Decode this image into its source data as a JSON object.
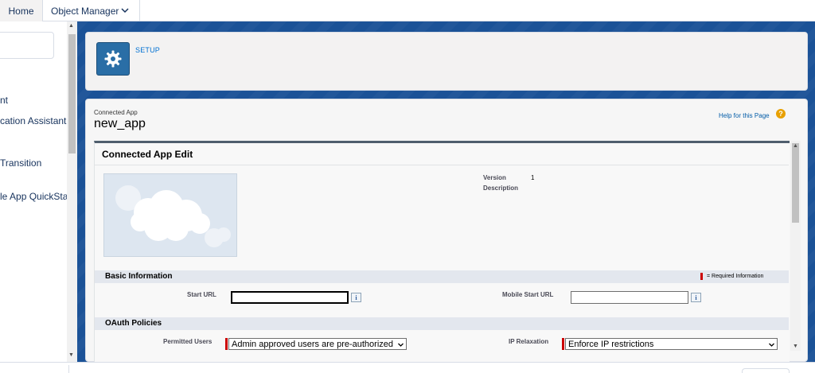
{
  "nav": {
    "home": "Home",
    "object_manager": "Object Manager"
  },
  "sidebar": {
    "items": [
      "nt",
      "cation Assistant",
      "Transition",
      "le App QuickStart"
    ]
  },
  "setup": {
    "label": "SETUP"
  },
  "page": {
    "subtitle": "Connected App",
    "title": "new_app",
    "help_link": "Help for this Page",
    "help_icon_glyph": "?"
  },
  "edit": {
    "title": "Connected App Edit",
    "version_label": "Version",
    "version_value": "1",
    "description_label": "Description"
  },
  "basic": {
    "title": "Basic Information",
    "required_note": "= Required Information",
    "start_url_label": "Start URL",
    "start_url_value": "",
    "mobile_start_url_label": "Mobile Start URL",
    "mobile_start_url_value": "",
    "info_glyph": "i"
  },
  "oauth": {
    "title": "OAuth Policies",
    "permitted_users_label": "Permitted Users",
    "permitted_users_value": "Admin approved users are pre-authorized",
    "ip_relaxation_label": "IP Relaxation",
    "ip_relaxation_value": "Enforce IP restrictions"
  },
  "colors": {
    "brand_blue": "#1b5297",
    "setup_icon": "#2a6ea6",
    "link": "#015ba7",
    "required": "#cc0000",
    "help": "#e8a000"
  },
  "icons": [
    "chevron-down-icon",
    "gear-icon",
    "help-icon",
    "info-icon",
    "salesforce-cloud-logo"
  ]
}
